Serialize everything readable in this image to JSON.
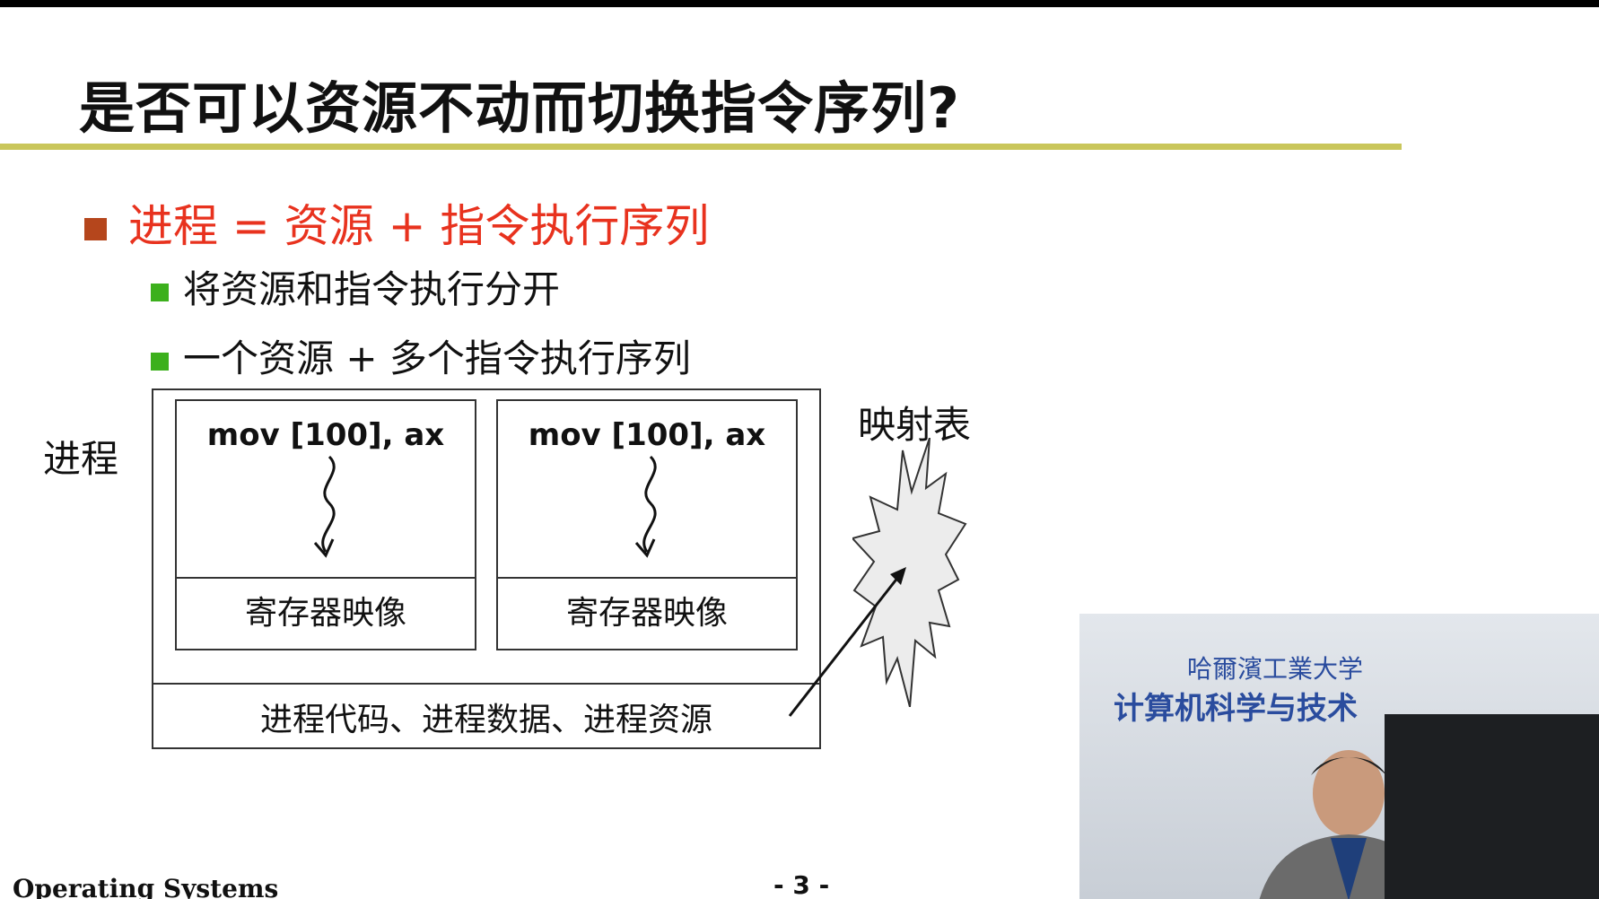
{
  "slide": {
    "title": "是否可以资源不动而切换指令序列?",
    "bullet_main": "进程 = 资源 + 指令执行序列",
    "bullet_sub_1": "将资源和指令执行分开",
    "bullet_sub_2": "一个资源 + 多个指令执行序列"
  },
  "diagram": {
    "process_label": "进程",
    "map_label": "映射表",
    "threads": [
      {
        "code": "mov [100], ax",
        "register": "寄存器映像"
      },
      {
        "code": "mov [100], ax",
        "register": "寄存器映像"
      }
    ],
    "shared_resources": "进程代码、进程数据、进程资源"
  },
  "footer": {
    "course": "Operating Systems",
    "page": "- 3 -"
  },
  "video": {
    "university_text": "哈爾濱工業大学",
    "department_text": "计算机科学与技术"
  },
  "colors": {
    "title_rule": "#c9c65b",
    "main_bullet_text": "#e8321e",
    "main_bullet_square": "#b5461c",
    "sub_bullet_square": "#3cb01c"
  }
}
